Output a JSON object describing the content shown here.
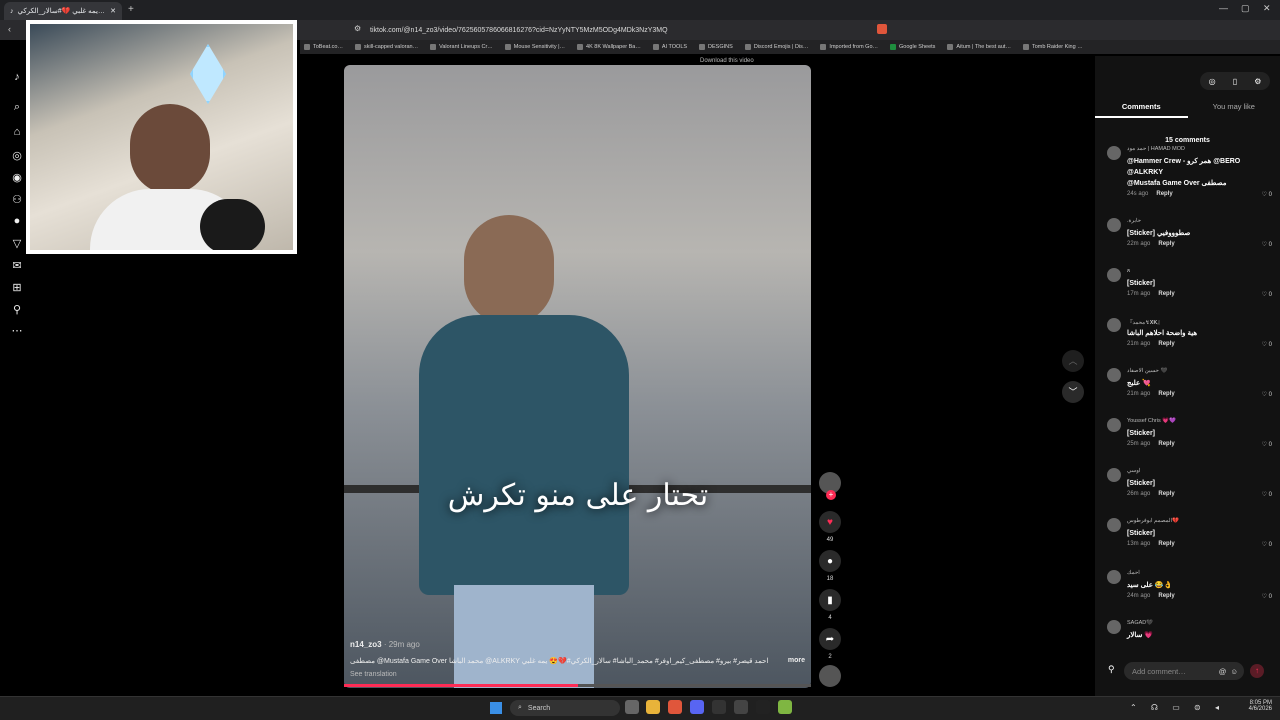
{
  "browser": {
    "tab_title": "يمه غلبي 💔#سالار_الكركي…",
    "new_tab": "+",
    "url": "tiktok.com/@n14_zo3/video/7625605786066816276?cid=NzYyNTY5MzM5ODg4MDk3NzY3MQ",
    "bookmarks": [
      "ToBeat.co…",
      "skill-capped valoran…",
      "Valorant Lineups Cr…",
      "Mouse Sensitivity |…",
      "4K 8K Wallpaper Ba…",
      "AI TOOLS",
      "DESGINS",
      "Discord Emojis | Dis…",
      "Imported from Go…",
      "Google Sheets",
      "Aitum | The best aut…",
      "Tomb Raider King …"
    ]
  },
  "video": {
    "overlay_text": "تحتار على منو تكرش",
    "author": "n14_zo3",
    "posted": "· 29m ago",
    "caption": "مصطفى @Mustafa Game Over محمد الباشا @ALKRKY احمد قيصر# بيرو# مصطفى_كيم_اوفر# محمد_الباشا# سالار_الكركي#💔😍 يمه غلبي",
    "more": "more",
    "see_translation": "See translation",
    "download_hint": "Download this video",
    "progress": 0.5
  },
  "actions": {
    "likes": "49",
    "comments": "18",
    "saves": "4",
    "shares": "2"
  },
  "panel": {
    "tab_comments": "Comments",
    "tab_like": "You may like",
    "count": "15 comments",
    "comments": [
      {
        "name": "حمد مود | HAMAD MOD",
        "lines": [
          "@Hammer Crew - همر كرو @BERO",
          "@ALKRKY",
          "@Mustafa Game Over مصطفى"
        ],
        "time": "24s ago",
        "likes": "0"
      },
      {
        "name": ".حابرة",
        "lines": [
          "[Sticker] صطوووفيي"
        ],
        "time": "22m ago",
        "likes": "0"
      },
      {
        "name": "ጸ",
        "lines": [
          "[Sticker]"
        ],
        "time": "17m ago",
        "likes": "0"
      },
      {
        "name": "『محمد↯𝐗𝐊』",
        "lines": [
          "هية واضحة احلاهم الباشا"
        ],
        "time": "21m ago",
        "likes": "0"
      },
      {
        "name": "حسين الاصفاد 🖤",
        "lines": [
          "علبج 💘"
        ],
        "time": "21m ago",
        "likes": "0"
      },
      {
        "name": "Youssef Chris 💗💜",
        "lines": [
          "[Sticker]"
        ],
        "time": "25m ago",
        "likes": "0"
      },
      {
        "name": "اوسي",
        "lines": [
          "[Sticker]"
        ],
        "time": "26m ago",
        "likes": "0"
      },
      {
        "name": "المصمم ابوفرطوس💔",
        "lines": [
          "[Sticker]"
        ],
        "time": "13m ago",
        "likes": "0"
      },
      {
        "name": "احمك",
        "lines": [
          "على سيد 😂👌"
        ],
        "time": "24m ago",
        "likes": "0"
      },
      {
        "name": "SAGAD🖤",
        "lines": [
          "سالار 💗"
        ],
        "time": "",
        "likes": ""
      }
    ],
    "reply": "Reply",
    "add_comment": "Add comment…"
  },
  "taskbar": {
    "search": "Search",
    "time": "8:05 PM",
    "date": "4/6/2026"
  }
}
